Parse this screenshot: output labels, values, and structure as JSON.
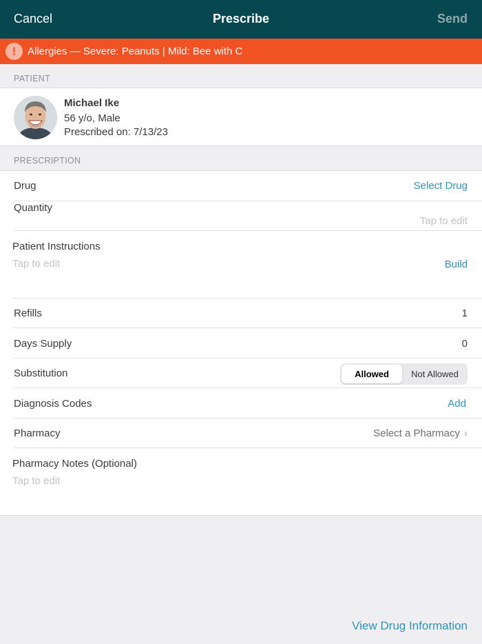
{
  "nav": {
    "cancel": "Cancel",
    "title": "Prescribe",
    "send": "Send"
  },
  "allergy": {
    "icon": "!",
    "text": "Allergies — Severe: Peanuts | Mild: Bee with C"
  },
  "patient": {
    "section": "PATIENT",
    "name": "Michael Ike",
    "age_sex": "56 y/o, Male",
    "prescribed_on": "Prescribed on: 7/13/23"
  },
  "prescription": {
    "section": "PRESCRIPTION",
    "drug": {
      "label": "Drug",
      "value": "Select Drug"
    },
    "quantity": {
      "label": "Quantity",
      "hint": "Tap to edit"
    },
    "instructions": {
      "label": "Patient Instructions",
      "hint": "Tap to edit",
      "action": "Build"
    },
    "refills": {
      "label": "Refills",
      "value": "1"
    },
    "days_supply": {
      "label": "Days Supply",
      "value": "0"
    },
    "substitution": {
      "label": "Substitution",
      "options": [
        "Allowed",
        "Not Allowed"
      ],
      "selected": "Allowed"
    },
    "diagnosis": {
      "label": "Diagnosis Codes",
      "action": "Add"
    },
    "pharmacy": {
      "label": "Pharmacy",
      "value": "Select a Pharmacy",
      "chevron": "›"
    },
    "pharmacy_notes": {
      "label": "Pharmacy Notes (Optional)",
      "hint": "Tap to edit"
    }
  },
  "footer": {
    "view_drug_info": "View Drug Information"
  },
  "colors": {
    "navbar": "#07474f",
    "alert": "#f05223",
    "link": "#2e94b9"
  }
}
